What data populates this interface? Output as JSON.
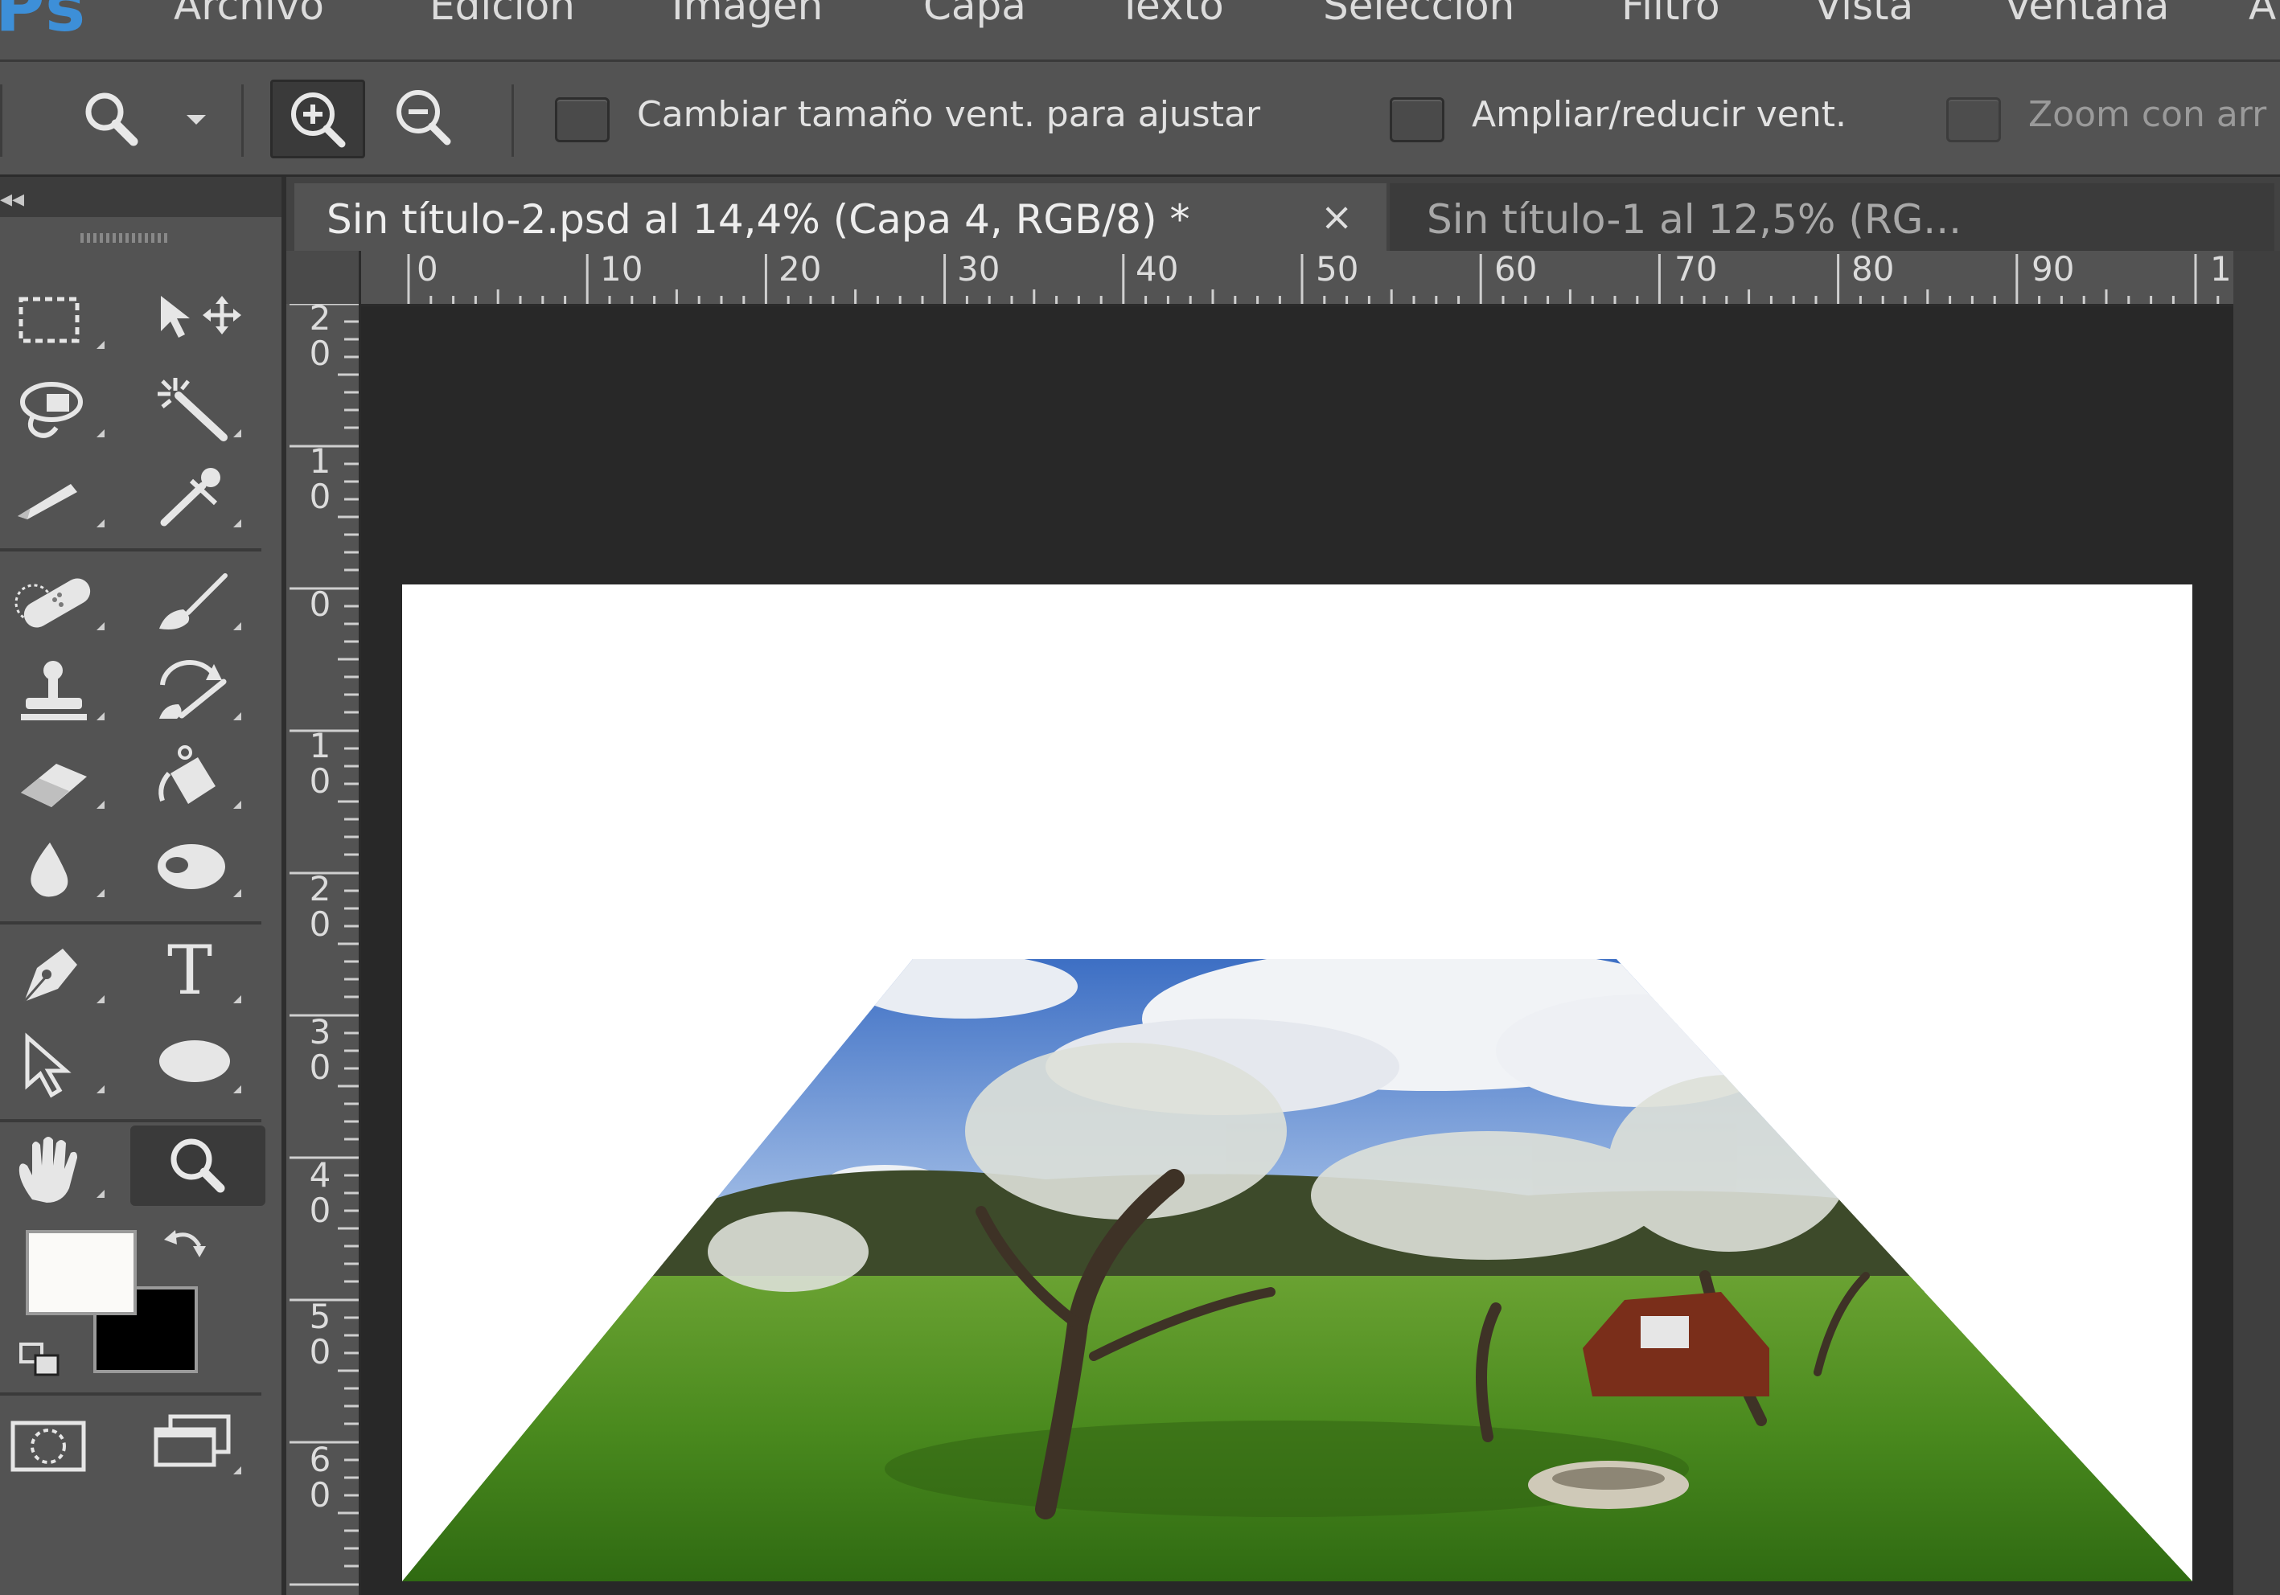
{
  "app": {
    "logo": "Ps"
  },
  "menu": {
    "items": [
      "Archivo",
      "Edición",
      "Imagen",
      "Capa",
      "Texto",
      "Selección",
      "Filtro",
      "Vista",
      "Ventana",
      "A"
    ]
  },
  "options_bar": {
    "zoom_tool_icon": "magnifier-icon",
    "zoom_in_icon": "zoom-in-icon",
    "zoom_out_icon": "zoom-out-icon",
    "checkboxes": [
      {
        "label": "Cambiar tamaño vent. para ajustar",
        "checked": false
      },
      {
        "label": "Ampliar/reducir vent.",
        "checked": false
      },
      {
        "label": "Zoom con arr",
        "checked": false,
        "disabled": true
      }
    ]
  },
  "toolbox": {
    "tools": [
      "rectangular-marquee-icon",
      "move-icon",
      "lasso-icon",
      "magic-wand-icon",
      "crop-icon",
      "eyedropper-icon",
      "healing-brush-icon",
      "brush-icon",
      "clone-stamp-icon",
      "history-brush-icon",
      "eraser-icon",
      "paint-bucket-icon",
      "blur-icon",
      "dodge-icon",
      "pen-icon",
      "type-icon",
      "path-selection-icon",
      "ellipse-icon",
      "hand-icon",
      "zoom-icon"
    ],
    "active_tool": "zoom-icon",
    "type_glyph": "T",
    "foreground_color": "#fbfaf8",
    "background_color": "#000000"
  },
  "tabs": [
    {
      "title": "Sin título-2.psd al 14,4% (Capa 4, RGB/8) *",
      "active": true,
      "close": "×"
    },
    {
      "title": "Sin título-1 al 12,5% (RG...",
      "active": false,
      "close": "×"
    }
  ],
  "rulers": {
    "top": [
      "0",
      "10",
      "20",
      "30",
      "40",
      "50",
      "60",
      "70",
      "80",
      "90",
      "1"
    ],
    "left": [
      "20",
      "10",
      "0",
      "10",
      "20",
      "30",
      "40",
      "50",
      "60"
    ]
  },
  "document": {
    "background": "#ffffff",
    "image_description_icon": "transformed-photo"
  }
}
